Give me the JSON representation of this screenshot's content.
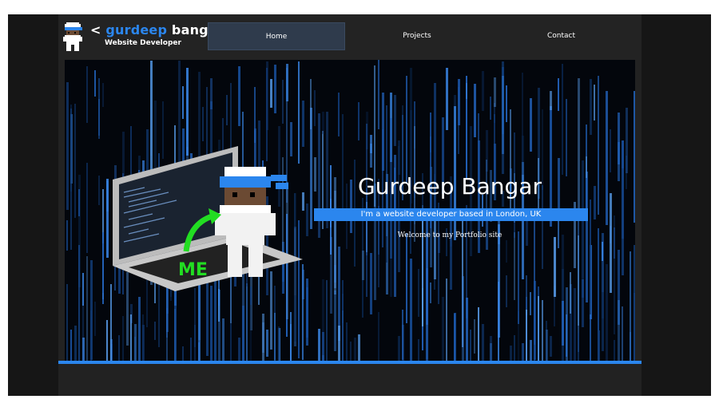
{
  "logo": {
    "title_open": "<",
    "title_accent": "gurdeep",
    "title_rest": "bangar",
    "title_close": "/>",
    "subtitle": "Website Developer",
    "avatar_icon": "pixel-ninja-icon"
  },
  "nav": {
    "items": [
      {
        "label": "Home",
        "active": true
      },
      {
        "label": "Projects",
        "active": false
      },
      {
        "label": "Contact",
        "active": false
      }
    ]
  },
  "hero": {
    "name": "Gurdeep Bangar",
    "tagline": "I'm a website developer based in London, UK",
    "welcome": "Welcome to my Portfolio site",
    "illustration_label": "ME",
    "background": "matrix-code-rain"
  },
  "colors": {
    "accent": "#2b86ee",
    "header_bg": "#232323",
    "page_bg": "#161616",
    "arrow": "#22dd22"
  }
}
